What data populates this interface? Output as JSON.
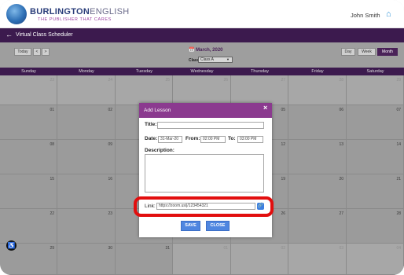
{
  "header": {
    "brand_main": "BURLINGTON",
    "brand_sub": "ENGLISH",
    "tagline": "THE PUBLISHER THAT CARES",
    "user_name": "John Smith"
  },
  "titlebar": {
    "title": "Virtual Class Scheduler"
  },
  "toolbar": {
    "today": "Today",
    "prev": "<",
    "next": ">",
    "month_label": "March, 2020",
    "class_label": "Class:",
    "class_value": "Class A",
    "views": [
      "Day",
      "Week",
      "Month"
    ],
    "active_view": "Month"
  },
  "calendar": {
    "weekdays": [
      "Sunday",
      "Monday",
      "Tuesday",
      "Wednesday",
      "Thursday",
      "Friday",
      "Saturday"
    ],
    "weeks": [
      [
        "23",
        "24",
        "25",
        "26",
        "27",
        "28",
        "29"
      ],
      [
        "01",
        "02",
        "03",
        "04",
        "05",
        "06",
        "07"
      ],
      [
        "08",
        "09",
        "10",
        "11",
        "12",
        "13",
        "14"
      ],
      [
        "15",
        "16",
        "17",
        "18",
        "19",
        "20",
        "21"
      ],
      [
        "22",
        "23",
        "24",
        "25",
        "26",
        "27",
        "28"
      ],
      [
        "29",
        "30",
        "31",
        "01",
        "02",
        "03",
        "04"
      ]
    ]
  },
  "modal": {
    "title": "Add Lesson",
    "close_icon": "×",
    "title_label": "Title:",
    "title_value": "",
    "date_label": "Date:",
    "date_value": "31-Mar-20",
    "from_label": "From:",
    "from_value": "02:00 PM",
    "to_label": "To:",
    "to_value": "03:00 PM",
    "description_label": "Description:",
    "description_value": "",
    "link_label": "Link:",
    "link_value": "https://zoom.us/j/123454321",
    "save_label": "SAVE",
    "close_label": "CLOSE"
  },
  "colors": {
    "accent": "#8b3a8f",
    "titlebar": "#3c1a4e",
    "highlight": "#e20e0e",
    "button": "#4f86e0"
  }
}
